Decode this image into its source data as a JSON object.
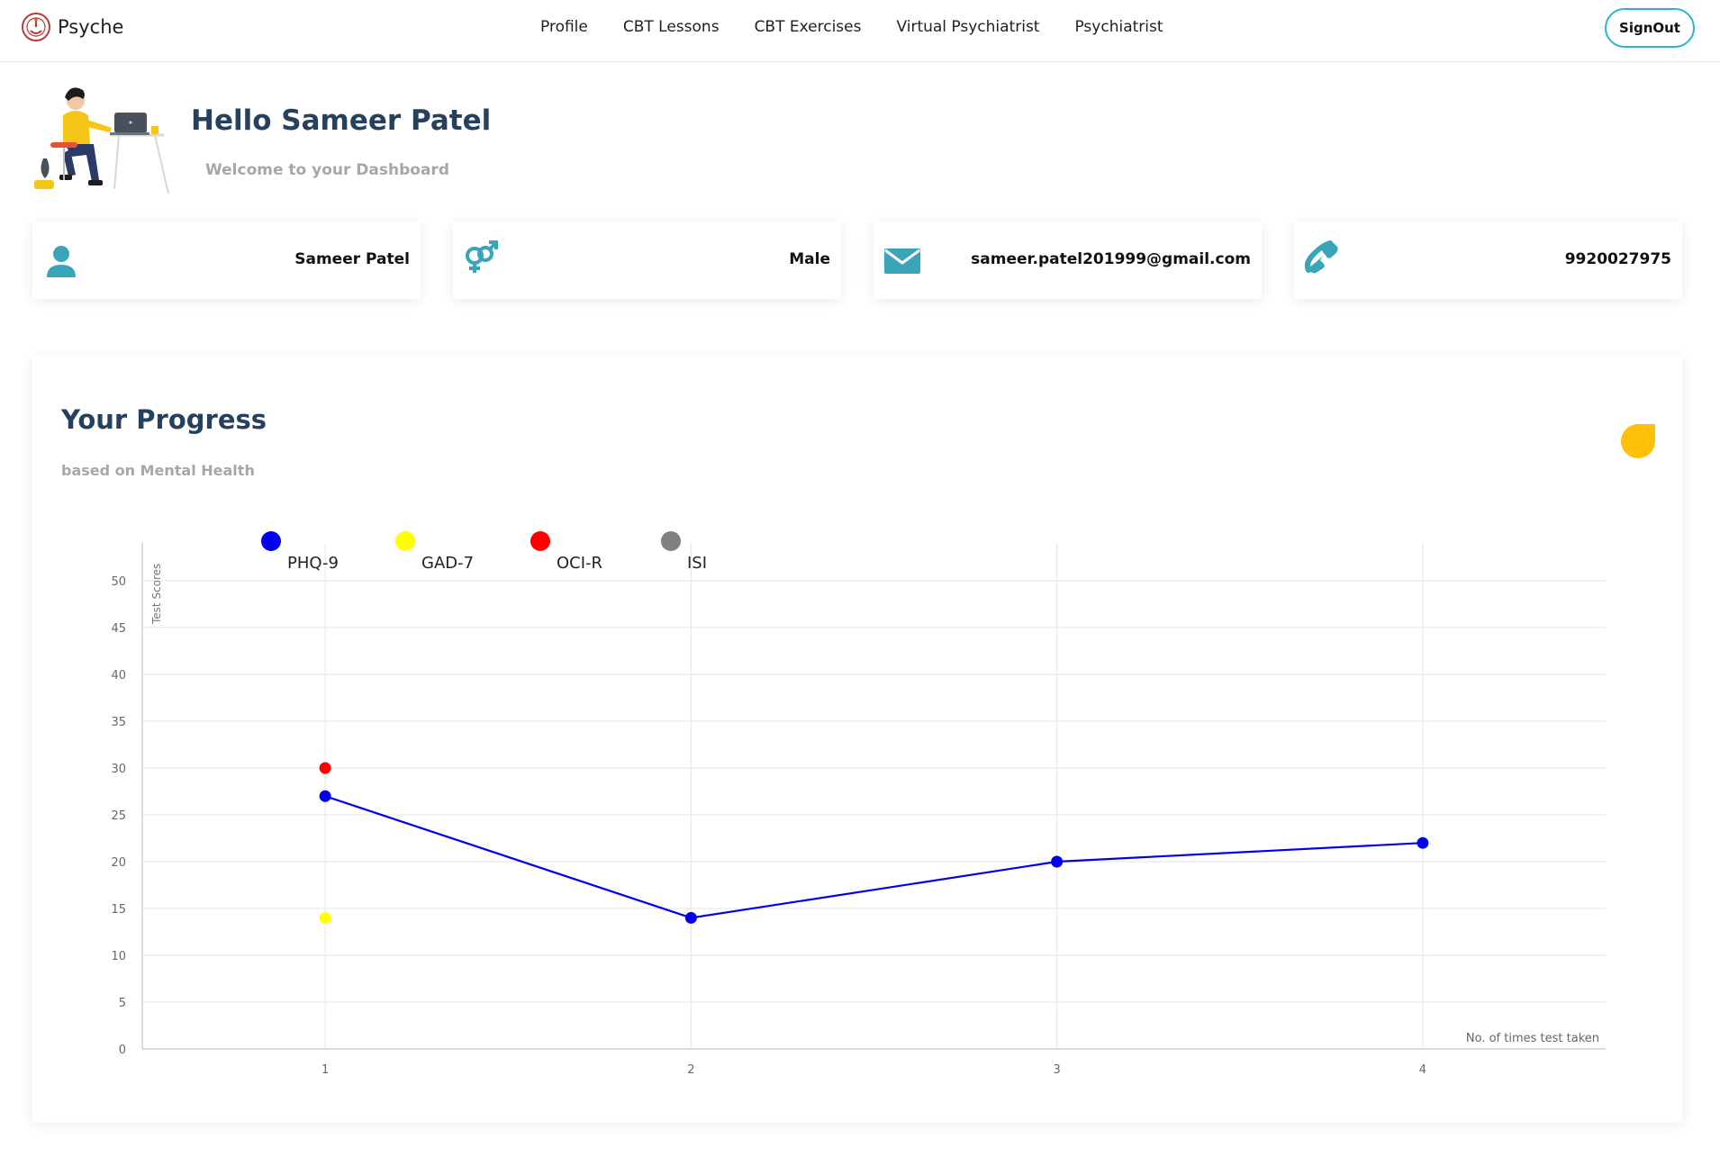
{
  "navbar": {
    "brand": "Psyche",
    "links": [
      "Profile",
      "CBT Lessons",
      "CBT Exercises",
      "Virtual Psychiatrist",
      "Psychiatrist"
    ],
    "signout_label": "SignOut"
  },
  "hero": {
    "greeting": "Hello Sameer Patel",
    "subtitle": "Welcome to your Dashboard"
  },
  "cards": {
    "name": "Sameer Patel",
    "gender": "Male",
    "email": "sameer.patel201999@gmail.com",
    "phone": "9920027975"
  },
  "progress": {
    "title": "Your Progress",
    "subtitle": "based on Mental Health"
  },
  "colors": {
    "primary": "#27405e",
    "accent": "#3aa5b9",
    "muted": "#a4a8ad",
    "drop": "#ffc107"
  },
  "chart_data": {
    "type": "line",
    "xlabel": "No. of times test taken",
    "ylabel": "Test Scores",
    "x": [
      1,
      2,
      3,
      4
    ],
    "xlim": [
      0.5,
      4.5
    ],
    "ylim": [
      0,
      50
    ],
    "yticks": [
      0,
      5,
      10,
      15,
      20,
      25,
      30,
      35,
      40,
      45,
      50
    ],
    "grid": true,
    "legend": "top-left",
    "series": [
      {
        "name": "PHQ-9",
        "color": "#0000ee",
        "values": [
          27,
          14,
          20,
          22
        ]
      },
      {
        "name": "GAD-7",
        "color": "#ffff00",
        "values": [
          14,
          null,
          null,
          null
        ]
      },
      {
        "name": "OCI-R",
        "color": "#ff0000",
        "values": [
          30,
          null,
          null,
          null
        ]
      },
      {
        "name": "ISI",
        "color": "#808080",
        "values": [
          null,
          null,
          null,
          null
        ]
      }
    ]
  }
}
